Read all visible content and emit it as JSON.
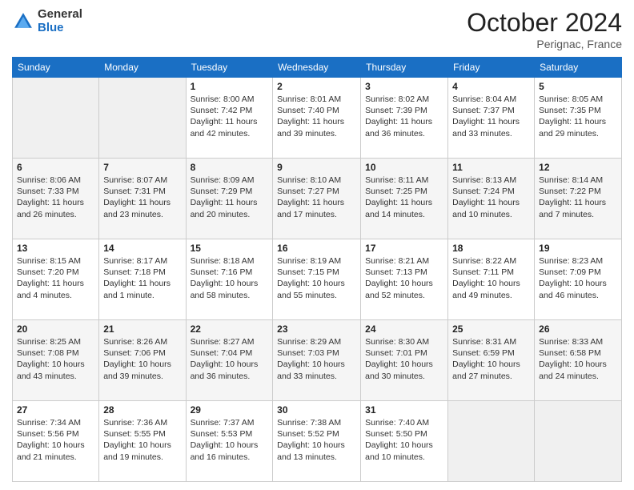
{
  "header": {
    "logo_general": "General",
    "logo_blue": "Blue",
    "month_year": "October 2024",
    "location": "Perignac, France"
  },
  "weekdays": [
    "Sunday",
    "Monday",
    "Tuesday",
    "Wednesday",
    "Thursday",
    "Friday",
    "Saturday"
  ],
  "weeks": [
    [
      {
        "day": "",
        "info": ""
      },
      {
        "day": "",
        "info": ""
      },
      {
        "day": "1",
        "info": "Sunrise: 8:00 AM\nSunset: 7:42 PM\nDaylight: 11 hours and 42 minutes."
      },
      {
        "day": "2",
        "info": "Sunrise: 8:01 AM\nSunset: 7:40 PM\nDaylight: 11 hours and 39 minutes."
      },
      {
        "day": "3",
        "info": "Sunrise: 8:02 AM\nSunset: 7:39 PM\nDaylight: 11 hours and 36 minutes."
      },
      {
        "day": "4",
        "info": "Sunrise: 8:04 AM\nSunset: 7:37 PM\nDaylight: 11 hours and 33 minutes."
      },
      {
        "day": "5",
        "info": "Sunrise: 8:05 AM\nSunset: 7:35 PM\nDaylight: 11 hours and 29 minutes."
      }
    ],
    [
      {
        "day": "6",
        "info": "Sunrise: 8:06 AM\nSunset: 7:33 PM\nDaylight: 11 hours and 26 minutes."
      },
      {
        "day": "7",
        "info": "Sunrise: 8:07 AM\nSunset: 7:31 PM\nDaylight: 11 hours and 23 minutes."
      },
      {
        "day": "8",
        "info": "Sunrise: 8:09 AM\nSunset: 7:29 PM\nDaylight: 11 hours and 20 minutes."
      },
      {
        "day": "9",
        "info": "Sunrise: 8:10 AM\nSunset: 7:27 PM\nDaylight: 11 hours and 17 minutes."
      },
      {
        "day": "10",
        "info": "Sunrise: 8:11 AM\nSunset: 7:25 PM\nDaylight: 11 hours and 14 minutes."
      },
      {
        "day": "11",
        "info": "Sunrise: 8:13 AM\nSunset: 7:24 PM\nDaylight: 11 hours and 10 minutes."
      },
      {
        "day": "12",
        "info": "Sunrise: 8:14 AM\nSunset: 7:22 PM\nDaylight: 11 hours and 7 minutes."
      }
    ],
    [
      {
        "day": "13",
        "info": "Sunrise: 8:15 AM\nSunset: 7:20 PM\nDaylight: 11 hours and 4 minutes."
      },
      {
        "day": "14",
        "info": "Sunrise: 8:17 AM\nSunset: 7:18 PM\nDaylight: 11 hours and 1 minute."
      },
      {
        "day": "15",
        "info": "Sunrise: 8:18 AM\nSunset: 7:16 PM\nDaylight: 10 hours and 58 minutes."
      },
      {
        "day": "16",
        "info": "Sunrise: 8:19 AM\nSunset: 7:15 PM\nDaylight: 10 hours and 55 minutes."
      },
      {
        "day": "17",
        "info": "Sunrise: 8:21 AM\nSunset: 7:13 PM\nDaylight: 10 hours and 52 minutes."
      },
      {
        "day": "18",
        "info": "Sunrise: 8:22 AM\nSunset: 7:11 PM\nDaylight: 10 hours and 49 minutes."
      },
      {
        "day": "19",
        "info": "Sunrise: 8:23 AM\nSunset: 7:09 PM\nDaylight: 10 hours and 46 minutes."
      }
    ],
    [
      {
        "day": "20",
        "info": "Sunrise: 8:25 AM\nSunset: 7:08 PM\nDaylight: 10 hours and 43 minutes."
      },
      {
        "day": "21",
        "info": "Sunrise: 8:26 AM\nSunset: 7:06 PM\nDaylight: 10 hours and 39 minutes."
      },
      {
        "day": "22",
        "info": "Sunrise: 8:27 AM\nSunset: 7:04 PM\nDaylight: 10 hours and 36 minutes."
      },
      {
        "day": "23",
        "info": "Sunrise: 8:29 AM\nSunset: 7:03 PM\nDaylight: 10 hours and 33 minutes."
      },
      {
        "day": "24",
        "info": "Sunrise: 8:30 AM\nSunset: 7:01 PM\nDaylight: 10 hours and 30 minutes."
      },
      {
        "day": "25",
        "info": "Sunrise: 8:31 AM\nSunset: 6:59 PM\nDaylight: 10 hours and 27 minutes."
      },
      {
        "day": "26",
        "info": "Sunrise: 8:33 AM\nSunset: 6:58 PM\nDaylight: 10 hours and 24 minutes."
      }
    ],
    [
      {
        "day": "27",
        "info": "Sunrise: 7:34 AM\nSunset: 5:56 PM\nDaylight: 10 hours and 21 minutes."
      },
      {
        "day": "28",
        "info": "Sunrise: 7:36 AM\nSunset: 5:55 PM\nDaylight: 10 hours and 19 minutes."
      },
      {
        "day": "29",
        "info": "Sunrise: 7:37 AM\nSunset: 5:53 PM\nDaylight: 10 hours and 16 minutes."
      },
      {
        "day": "30",
        "info": "Sunrise: 7:38 AM\nSunset: 5:52 PM\nDaylight: 10 hours and 13 minutes."
      },
      {
        "day": "31",
        "info": "Sunrise: 7:40 AM\nSunset: 5:50 PM\nDaylight: 10 hours and 10 minutes."
      },
      {
        "day": "",
        "info": ""
      },
      {
        "day": "",
        "info": ""
      }
    ]
  ]
}
